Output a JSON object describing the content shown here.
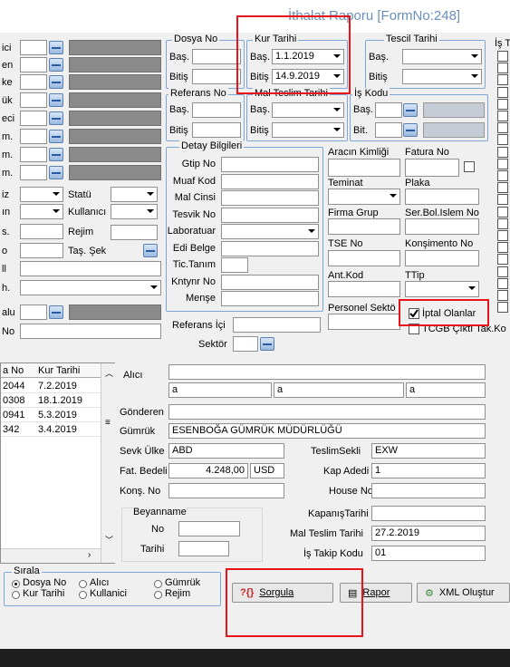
{
  "title": "İthalat Raporu [FormNo:248]",
  "left_labels": [
    "ici",
    "en",
    "ke",
    "ük",
    "eci",
    "m.",
    "m.",
    "m.",
    "iz",
    "ın",
    "s.",
    "o",
    "ll",
    "h.",
    "alu",
    "No"
  ],
  "left_fields": {
    "statu": "Statü",
    "kullanici": "Kullanıcı",
    "rejim": "Rejim",
    "tas_sek": "Taş. Şek"
  },
  "dosya_no": {
    "title": "Dosya No",
    "bas": "Baş.",
    "bitis": "Bitiş"
  },
  "kur_tarihi": {
    "title": "Kur Tarihi",
    "bas": "Baş.",
    "bas_val": "1.1.2019",
    "bitis": "Bitiş",
    "bitis_val": "14.9.2019"
  },
  "tescil_tarihi": {
    "title": "Tescil Tarihi",
    "bas": "Baş.",
    "bitis": "Bitiş"
  },
  "referans_no": {
    "title": "Referans No",
    "bas": "Baş.",
    "bitis": "Bitiş"
  },
  "mal_teslim_tarihi": {
    "title": "Mal Teslim Tarihi",
    "bas": "Baş.",
    "bitis": "Bitiş"
  },
  "is_kodu": {
    "title": "İş Kodu",
    "bas": "Baş.",
    "bit": "Bit."
  },
  "is_t": "İş T",
  "detay": {
    "title": "Detay Bilgileri",
    "rows": [
      "Gtip No",
      "Muaf Kod",
      "Mal Cinsi",
      "Tesvik No",
      "Laboratuar",
      "Edi Belge",
      "Tic.Tanım",
      "Kntynr No",
      "Menşe"
    ]
  },
  "right_labels": {
    "aracin_kimligi": "Aracın Kimliği",
    "fatura_no": "Fatura No",
    "teminat": "Teminat",
    "plaka": "Plaka",
    "firma_grup": "Firma Grup",
    "ser_bol": "Ser.Bol.Islem No",
    "tse_no": "TSE No",
    "konsimento": "Konşimento No",
    "ant_kod": "Ant.Kod",
    "ttip": "TTip",
    "personel": "Personel Sektö"
  },
  "iptal_olanlar": "İptal Olanlar",
  "tcgb": "TCGB Çıktı Tak.Ko",
  "referans_ici": "Referans İçi",
  "sektor": "Sektör",
  "grid": {
    "headers": [
      "a No",
      "Kur Tarihi"
    ],
    "rows": [
      [
        "2044",
        "7.2.2019"
      ],
      [
        "0308",
        "18.1.2019"
      ],
      [
        "0941",
        "5.3.2019"
      ],
      [
        "342",
        "3.4.2019"
      ]
    ]
  },
  "detail": {
    "alici": "Alıcı",
    "alici_a1": "a",
    "alici_a2": "a",
    "alici_a3": "a",
    "gonderen": "Gönderen",
    "gumruk": "Gümrük",
    "gumruk_val": "ESENBOĞA GÜMRÜK MÜDÜRLÜĞÜ",
    "sevk_ulke": "Sevk Ülke",
    "sevk_val": "ABD",
    "teslim_sekli": "TeslimSekli",
    "teslim_val": "EXW",
    "fat_bedeli": "Fat. Bedeli",
    "fat_val": "4.248,00",
    "fat_cur": "USD",
    "kap_adedi": "Kap Adedi",
    "kap_val": "1",
    "kons_no": "Konş. No",
    "house_no": "House No",
    "beyanname": "Beyanname",
    "no": "No",
    "tarihi": "Tarihi",
    "kapanis": "KapanışTarihi",
    "mal_teslim": "Mal Teslim Tarihi",
    "mal_teslim_val": "27.2.2019",
    "is_takip": "İş Takip Kodu",
    "is_takip_val": "01"
  },
  "sirala": {
    "title": "Sırala",
    "options": [
      "Dosya No",
      "Kur Tarihi",
      "Alıcı",
      "Kullanici",
      "Gümrük",
      "Rejim"
    ]
  },
  "buttons": {
    "sorgula": "Sorgula",
    "rapor": "Rapor",
    "xml": "XML Oluştur"
  },
  "colors": {
    "highlight": "#e8141b",
    "group_border": "#7ea7d8",
    "title": "#6a8fb8"
  }
}
